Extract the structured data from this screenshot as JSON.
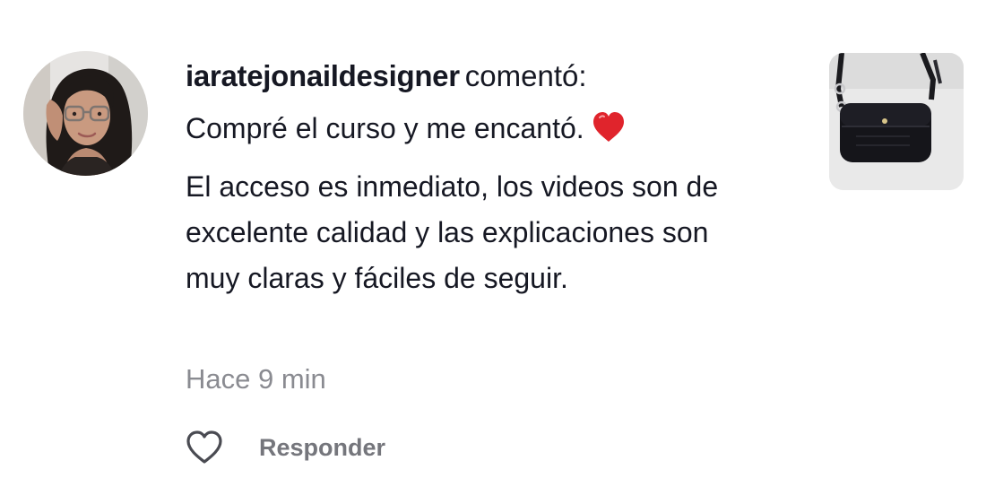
{
  "comment": {
    "avatar_icon": "user-avatar-photo",
    "username": "iaratejonaildesigner",
    "action_text": "comentó:",
    "first_line": "Compré el curso y me encantó.",
    "emoji_icon": "red-heart-emoji",
    "paragraph": "El acceso es inmediato, los videos son de excelente calidad y las explicaciones son muy claras y fáciles de seguir.",
    "timestamp": "Hace 9 min",
    "like_icon": "heart-outline-icon",
    "reply_label": "Responder",
    "thumbnail_icon": "crochet-bag-product-photo"
  },
  "colors": {
    "text_primary": "#161823",
    "text_secondary": "#8a8b91",
    "reply_gray": "#75767c",
    "emoji_red": "#e0242c"
  }
}
